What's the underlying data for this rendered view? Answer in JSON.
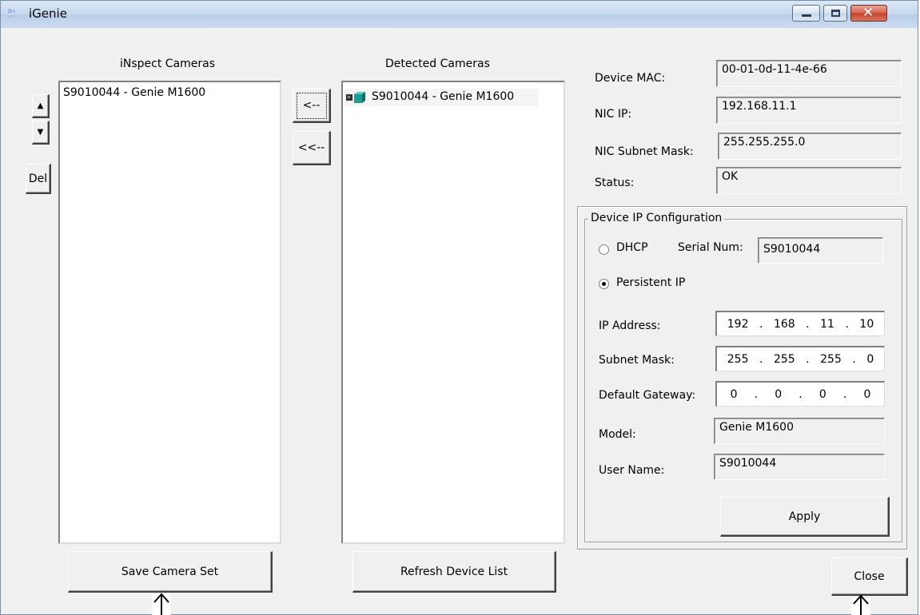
{
  "window": {
    "title": "iGenie"
  },
  "left_panel": {
    "heading": "iNspect Cameras",
    "items": [
      "S9010044 - Genie M1600"
    ],
    "up_label": "▲",
    "down_label": "▼",
    "del_label": "Del",
    "save_label": "Save Camera Set"
  },
  "transfer": {
    "single_label": "<--",
    "all_label": "<<--"
  },
  "detected_panel": {
    "heading": "Detected Cameras",
    "items": [
      "S9010044 - Genie M1600"
    ],
    "refresh_label": "Refresh Device List"
  },
  "device_info": {
    "mac_label": "Device MAC:",
    "mac_value": "00-01-0d-11-4e-66",
    "nicip_label": "NIC IP:",
    "nicip_value": "192.168.11.1",
    "mask_label": "NIC Subnet Mask:",
    "mask_value": "255.255.255.0",
    "status_label": "Status:",
    "status_value": "OK"
  },
  "ip_config": {
    "group_title": "Device IP Configuration",
    "dhcp_label": "DHCP",
    "serial_label": "Serial Num:",
    "serial_value": "S9010044",
    "persistent_label": "Persistent IP",
    "selected_mode": "Persistent IP",
    "ip_label": "IP Address:",
    "ip_octets": [
      "192",
      "168",
      "11",
      "10"
    ],
    "subnet_label": "Subnet Mask:",
    "subnet_octets": [
      "255",
      "255",
      "255",
      "0"
    ],
    "gateway_label": "Default Gateway:",
    "gateway_octets": [
      "0",
      "0",
      "0",
      "0"
    ],
    "model_label": "Model:",
    "model_value": "Genie M1600",
    "user_label": "User Name:",
    "user_value": "S9010044",
    "apply_label": "Apply"
  },
  "close_label": "Close",
  "colors": {
    "titlebar": "#c5d8ee",
    "close_button": "#c2412c",
    "face": "#f0f0f0"
  }
}
